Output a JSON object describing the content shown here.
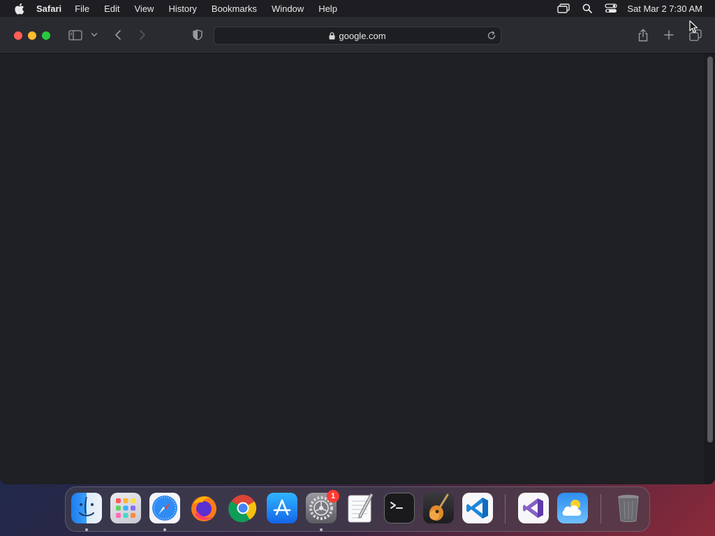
{
  "menubar": {
    "app_name": "Safari",
    "items": [
      "File",
      "Edit",
      "View",
      "History",
      "Bookmarks",
      "Window",
      "Help"
    ],
    "clock": "Sat Mar 2  7:30 AM",
    "icons": [
      "apple-icon",
      "screen-mirroring-icon",
      "spotlight-search-icon",
      "control-center-icon"
    ]
  },
  "safari": {
    "address": "google.com"
  },
  "dock": {
    "apps": [
      "Finder",
      "Launchpad",
      "Safari",
      "Firefox",
      "Google Chrome",
      "App Store",
      "System Settings",
      "TextEdit",
      "Terminal",
      "GarageBand",
      "Visual Studio Code",
      "Visual Studio",
      "Weather",
      "Trash"
    ],
    "system_settings_badge": "1"
  },
  "colors": {
    "close": "#ff5f57",
    "minimize": "#febc2e",
    "maximize": "#28c840",
    "window_bg": "#1f2024",
    "toolbar_bg": "#2a2b30"
  }
}
